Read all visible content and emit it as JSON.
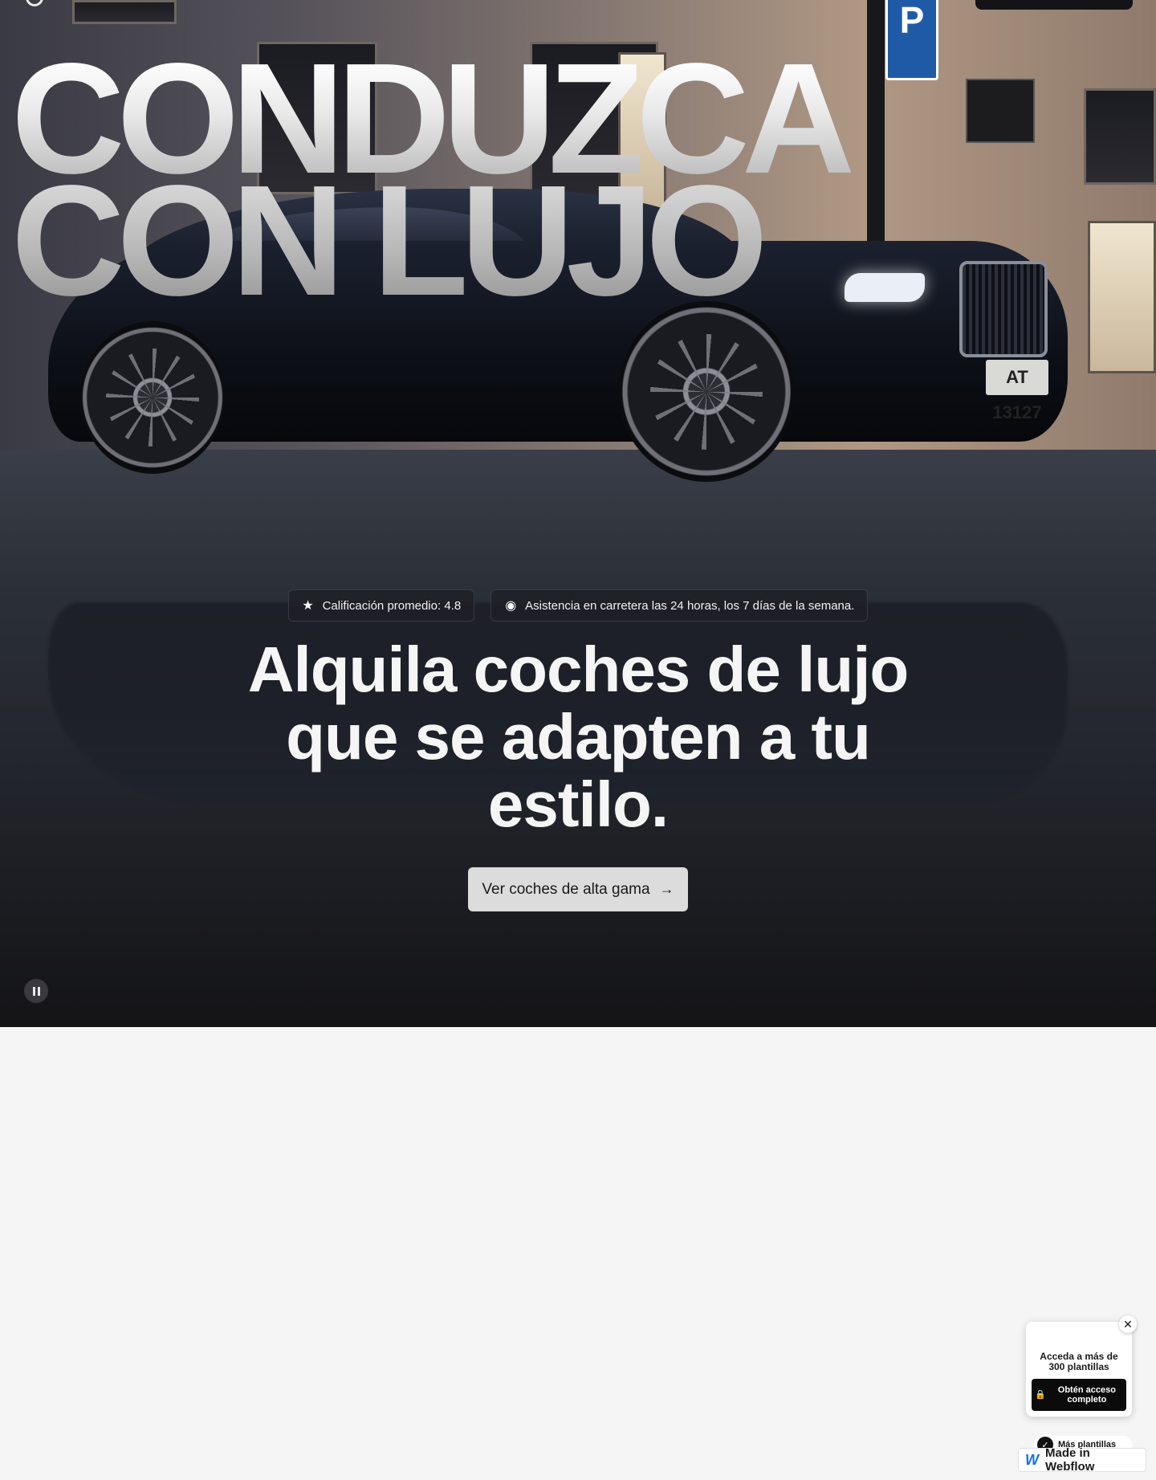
{
  "hero": {
    "big_title_line1": "CONDUZCA",
    "big_title_line2": "CON LUJO",
    "plate_text": "AT 13127",
    "parking_sign": "P",
    "badges": [
      {
        "icon": "star-icon",
        "glyph": "★",
        "label": "Calificación promedio: 4.8"
      },
      {
        "icon": "support-icon",
        "glyph": "◉",
        "label": "Asistencia en carretera las 24 horas, los 7 días de la semana."
      }
    ],
    "heading_lines": [
      "Alquila coches de lujo",
      "que se adapten a tu",
      "estilo."
    ],
    "cta_label": "Ver coches de alta gama",
    "cta_arrow": "→"
  },
  "promo": {
    "close_glyph": "✕",
    "title": "Acceda a más de 300 plantillas",
    "button_label": "Obtén acceso completo",
    "lock_glyph": "🔒"
  },
  "more_templates": {
    "label": "Más plantillas"
  },
  "webflow_badge": {
    "label": "Made in Webflow"
  },
  "colors": {
    "hero_dark": "#151518",
    "page_bg": "#f5f5f5",
    "cta_bg": "#dcdcdc",
    "webflow_blue": "#146ef5"
  }
}
